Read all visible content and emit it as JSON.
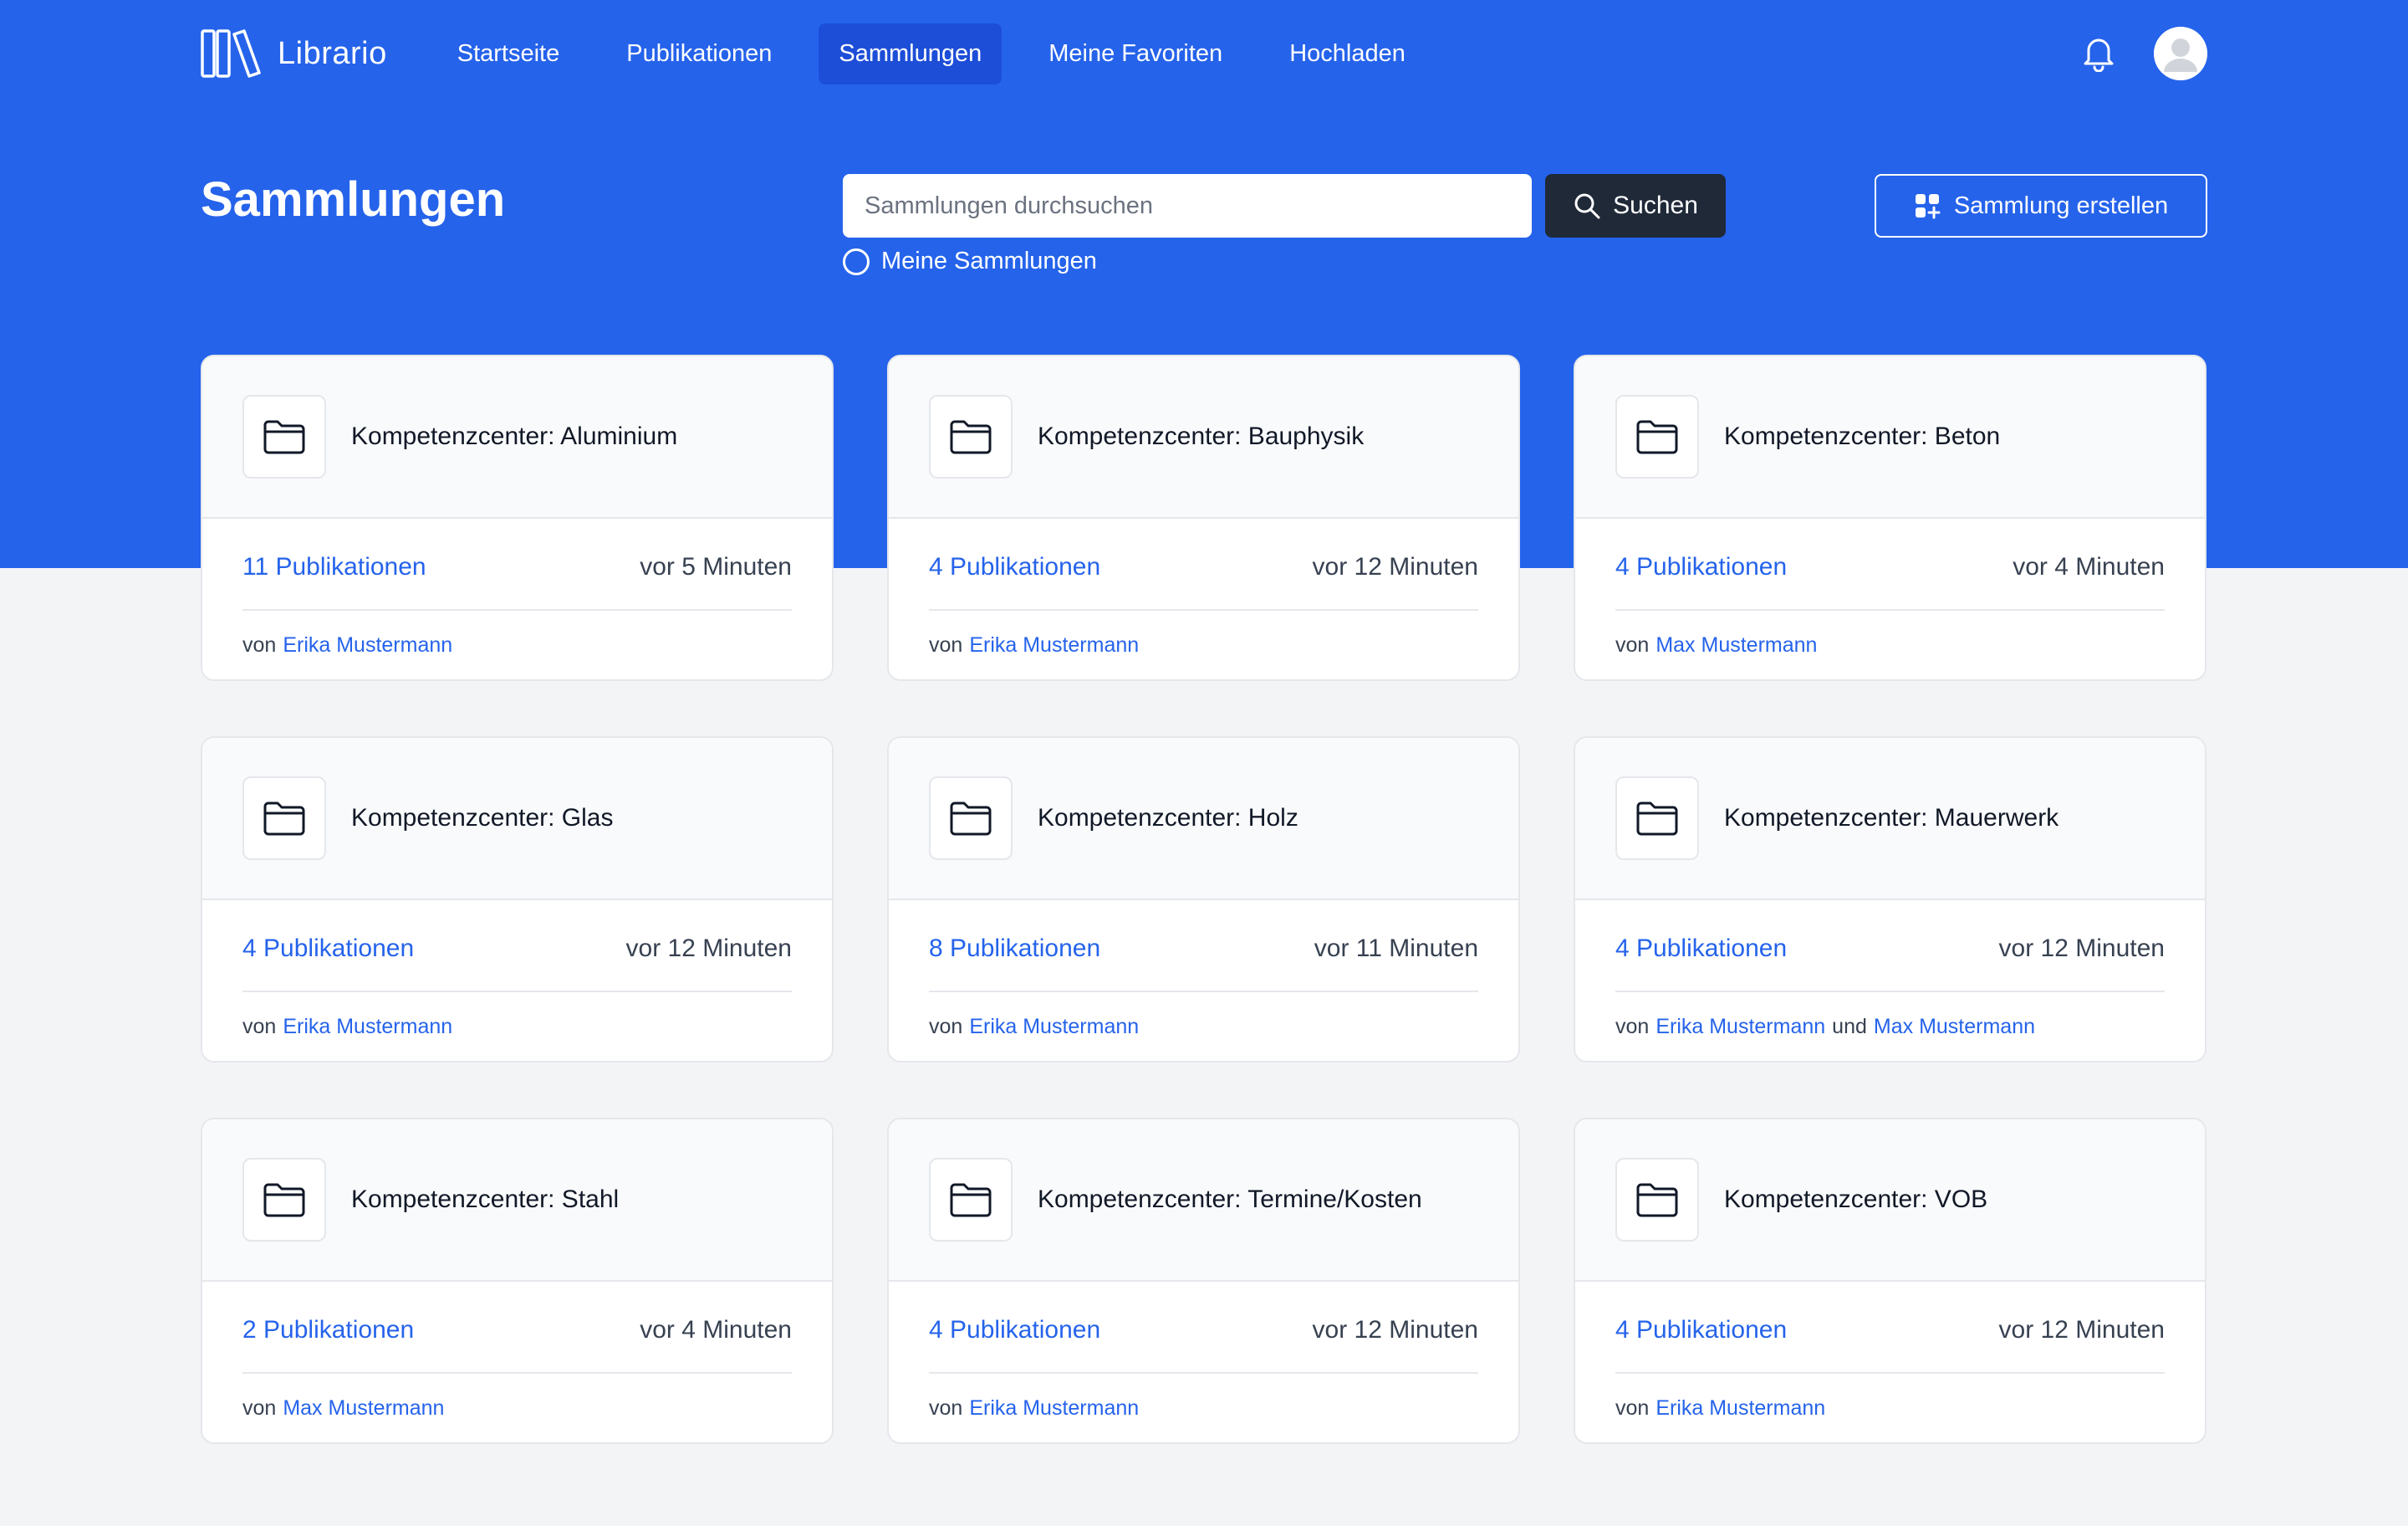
{
  "brand": {
    "name": "Librario"
  },
  "nav": {
    "items": [
      {
        "label": "Startseite",
        "active": false
      },
      {
        "label": "Publikationen",
        "active": false
      },
      {
        "label": "Sammlungen",
        "active": true
      },
      {
        "label": "Meine Favoriten",
        "active": false
      },
      {
        "label": "Hochladen",
        "active": false
      }
    ]
  },
  "header": {
    "title": "Sammlungen",
    "search_placeholder": "Sammlungen durchsuchen",
    "search_value": "",
    "search_button": "Suchen",
    "filter_label": "Meine Sammlungen",
    "filter_checked": false,
    "create_button": "Sammlung erstellen"
  },
  "colors": {
    "primary": "#2563eb",
    "active_nav": "#1d4ed8",
    "dark_button": "#1f2937",
    "link": "#2563eb"
  },
  "collections": [
    {
      "title": "Kompetenzcenter: Aluminium",
      "publications": "11 Publikationen",
      "updated": "vor 5 Minuten",
      "by": "von",
      "authors": [
        "Erika Mustermann"
      ]
    },
    {
      "title": "Kompetenzcenter: Bauphysik",
      "publications": "4 Publikationen",
      "updated": "vor 12 Minuten",
      "by": "von",
      "authors": [
        "Erika Mustermann"
      ]
    },
    {
      "title": "Kompetenzcenter: Beton",
      "publications": "4 Publikationen",
      "updated": "vor 4 Minuten",
      "by": "von",
      "authors": [
        "Max Mustermann"
      ]
    },
    {
      "title": "Kompetenzcenter: Glas",
      "publications": "4 Publikationen",
      "updated": "vor 12 Minuten",
      "by": "von",
      "authors": [
        "Erika Mustermann"
      ]
    },
    {
      "title": "Kompetenzcenter: Holz",
      "publications": "8 Publikationen",
      "updated": "vor 11 Minuten",
      "by": "von",
      "authors": [
        "Erika Mustermann"
      ]
    },
    {
      "title": "Kompetenzcenter: Mauerwerk",
      "publications": "4 Publikationen",
      "updated": "vor 12 Minuten",
      "by": "von",
      "authors": [
        "Erika Mustermann",
        "Max Mustermann"
      ],
      "conjunction": "und"
    },
    {
      "title": "Kompetenzcenter: Stahl",
      "publications": "2 Publikationen",
      "updated": "vor 4 Minuten",
      "by": "von",
      "authors": [
        "Max Mustermann"
      ]
    },
    {
      "title": "Kompetenzcenter: Termine/Kosten",
      "publications": "4 Publikationen",
      "updated": "vor 12 Minuten",
      "by": "von",
      "authors": [
        "Erika Mustermann"
      ]
    },
    {
      "title": "Kompetenzcenter: VOB",
      "publications": "4 Publikationen",
      "updated": "vor 12 Minuten",
      "by": "von",
      "authors": [
        "Erika Mustermann"
      ]
    }
  ]
}
